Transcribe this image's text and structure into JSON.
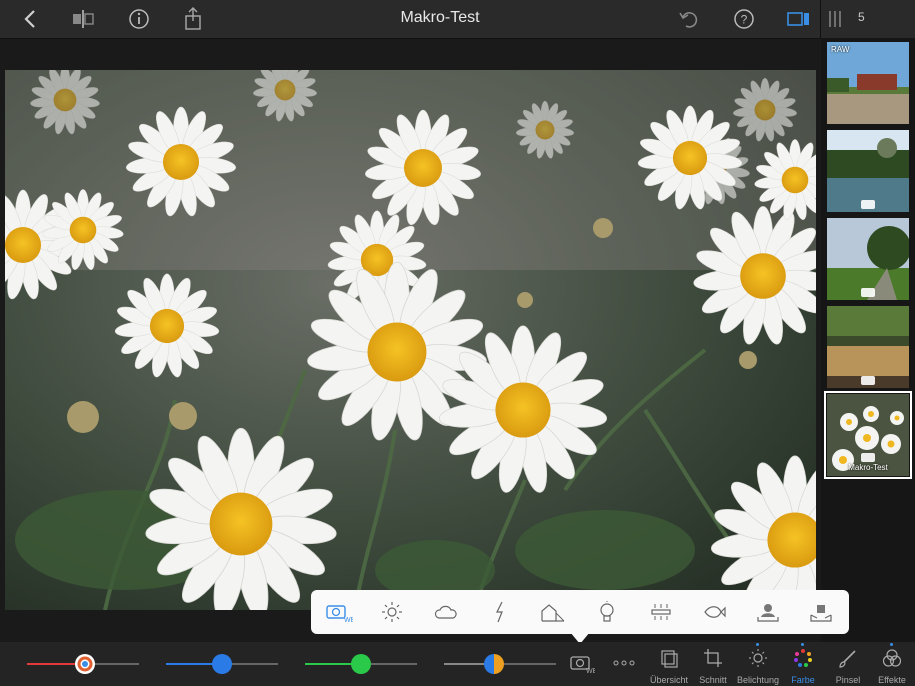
{
  "header": {
    "title": "Makro-Test",
    "image_count": "5"
  },
  "filmstrip": {
    "items": [
      {
        "badge": "RAW",
        "name": ""
      },
      {
        "badge": "",
        "name": ""
      },
      {
        "badge": "",
        "name": ""
      },
      {
        "badge": "",
        "name": ""
      },
      {
        "badge": "",
        "name": "Makro-Test"
      }
    ]
  },
  "wb_popup": {
    "wb_label": "WB",
    "tools": [
      "camera-wb-icon",
      "sun-icon",
      "cloud-icon",
      "flash-icon",
      "shade-icon",
      "tungsten-bulb-icon",
      "fluorescent-icon",
      "underwater-fish-icon",
      "picker-portrait-icon",
      "picker-gray-icon"
    ]
  },
  "sliders": [
    {
      "name": "temperature",
      "color_left": "#e03a3a",
      "value": 0.52
    },
    {
      "name": "tint",
      "color_left": "#2a7be6",
      "value": 0.5
    },
    {
      "name": "saturation",
      "color_left": "#2ac94a",
      "value": 0.5
    },
    {
      "name": "vibrance",
      "color_left": "#f0a020",
      "value": 0.44
    }
  ],
  "bottom_tabs": [
    {
      "label": "Übersicht",
      "active": false
    },
    {
      "label": "Schnitt",
      "active": false
    },
    {
      "label": "Belichtung",
      "active": false
    },
    {
      "label": "Farbe",
      "active": true
    },
    {
      "label": "Pinsel",
      "active": false
    },
    {
      "label": "Effekte",
      "active": false
    }
  ],
  "colors": {
    "accent": "#3a8ee6"
  }
}
